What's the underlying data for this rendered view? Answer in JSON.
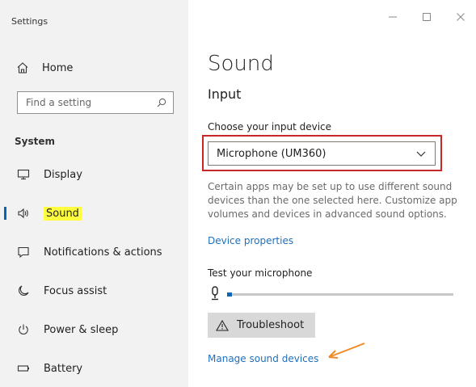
{
  "window": {
    "title": "Settings"
  },
  "sidebar": {
    "home_label": "Home",
    "search_placeholder": "Find a setting",
    "section_label": "System",
    "items": [
      {
        "label": "Display",
        "icon": "monitor-icon",
        "active": false
      },
      {
        "label": "Sound",
        "icon": "speaker-icon",
        "active": true
      },
      {
        "label": "Notifications & actions",
        "icon": "notification-icon",
        "active": false
      },
      {
        "label": "Focus assist",
        "icon": "moon-icon",
        "active": false
      },
      {
        "label": "Power & sleep",
        "icon": "power-icon",
        "active": false
      },
      {
        "label": "Battery",
        "icon": "battery-icon",
        "active": false
      }
    ]
  },
  "main": {
    "page_title": "Sound",
    "section_title": "Input",
    "choose_label": "Choose your input device",
    "input_device": "Microphone  (UM360)",
    "info_text": "Certain apps may be set up to use different sound\ndevices than the one selected here. Customize app\nvolumes and devices in advanced sound options.",
    "device_properties_link": "Device properties",
    "test_label": "Test your microphone",
    "mic_level_percent": 1,
    "troubleshoot_label": "Troubleshoot",
    "manage_link": "Manage sound devices"
  },
  "colors": {
    "accent": "#0b64b4",
    "highlight": "#ffff40",
    "annotation_box": "#c62828",
    "annotation_arrow": "#f08a24"
  }
}
